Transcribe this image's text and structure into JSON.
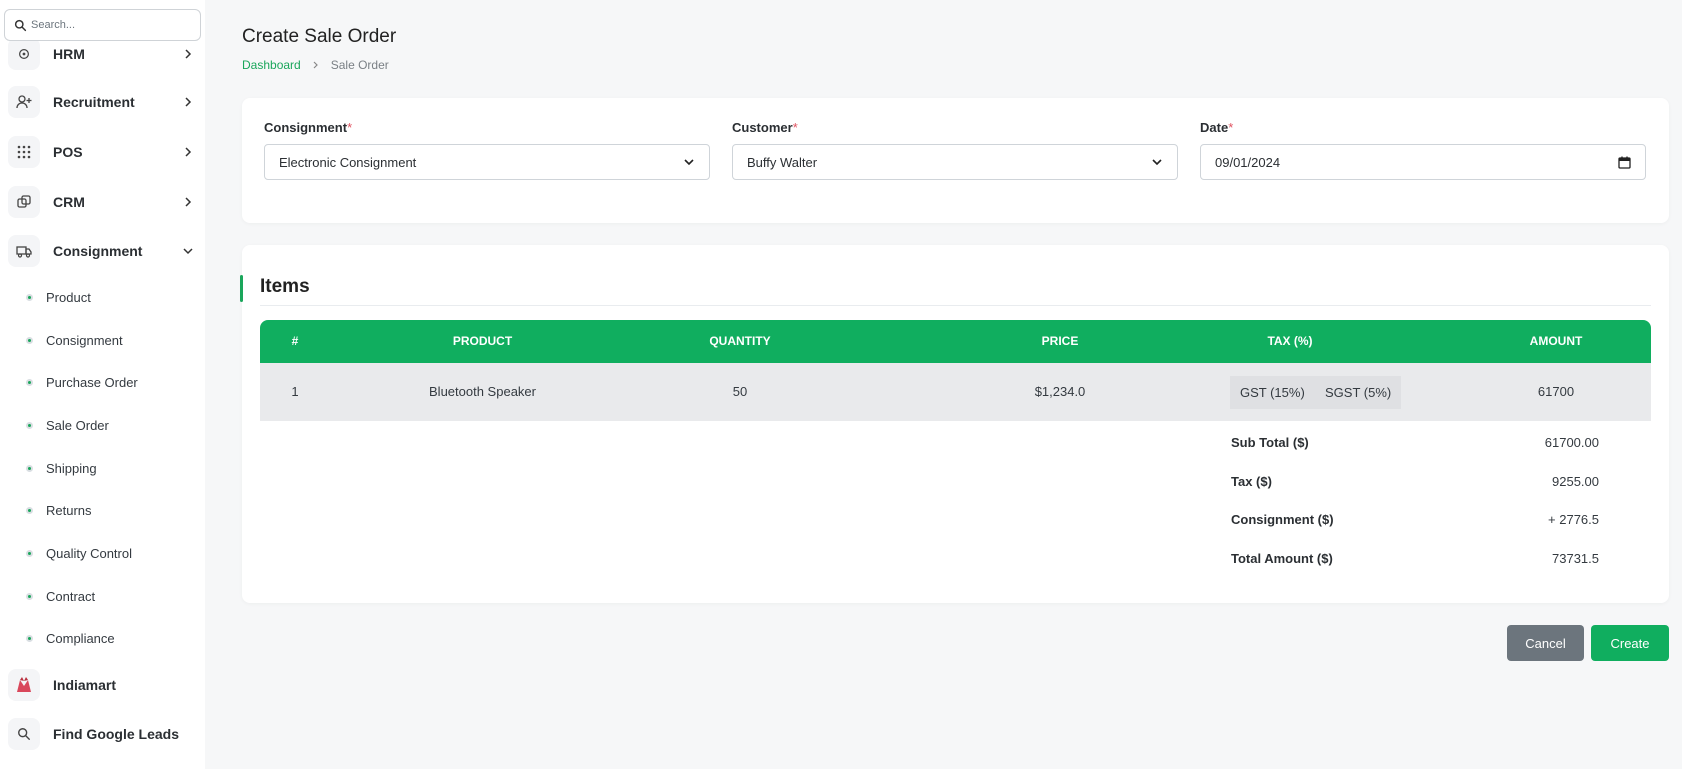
{
  "sidebar": {
    "search": {
      "placeholder": "Search..."
    },
    "menu": [
      {
        "label": "HRM",
        "icon": "hrm-icon"
      },
      {
        "label": "Recruitment",
        "icon": "user-plus-icon"
      },
      {
        "label": "POS",
        "icon": "grid-dots-icon"
      },
      {
        "label": "CRM",
        "icon": "crm-icon"
      },
      {
        "label": "Consignment",
        "icon": "truck-icon",
        "expanded": true
      }
    ],
    "consignment_items": [
      "Product",
      "Consignment",
      "Purchase Order",
      "Sale Order",
      "Shipping",
      "Returns",
      "Quality Control",
      "Contract",
      "Compliance"
    ],
    "bottom": [
      {
        "label": "Indiamart",
        "icon": "indiamart-logo-icon"
      },
      {
        "label": "Find Google Leads",
        "icon": "search-icon"
      }
    ]
  },
  "page": {
    "title": "Create Sale Order",
    "breadcrumb": {
      "home": "Dashboard",
      "current": "Sale Order"
    }
  },
  "form": {
    "consignment": {
      "label": "Consignment",
      "required": "*",
      "value": "Electronic Consignment"
    },
    "customer": {
      "label": "Customer",
      "required": "*",
      "value": "Buffy Walter"
    },
    "date": {
      "label": "Date",
      "required": "*",
      "value": "09/01/2024"
    }
  },
  "items": {
    "title": "Items",
    "headers": {
      "num": "#",
      "product": "PRODUCT",
      "quantity": "QUANTITY",
      "price": "PRICE",
      "tax": "TAX (%)",
      "amount": "AMOUNT"
    },
    "rows": [
      {
        "num": "1",
        "product": "Bluetooth Speaker",
        "quantity": "50",
        "price": "$1,234.0",
        "taxes": [
          "GST (15%)",
          "SGST (5%)"
        ],
        "amount": "61700"
      }
    ],
    "summary": {
      "sub_total": {
        "label": "Sub Total ($)",
        "value": "61700.00"
      },
      "tax": {
        "label": "Tax ($)",
        "value": "9255.00"
      },
      "consignment": {
        "label": "Consignment ($)",
        "value": "+ 2776.5"
      },
      "total": {
        "label": "Total Amount ($)",
        "value": "73731.5"
      }
    }
  },
  "actions": {
    "cancel": "Cancel",
    "create": "Create"
  },
  "colors": {
    "accent": "#10ae5f",
    "secondary": "#6c757d",
    "required": "#e05260"
  }
}
